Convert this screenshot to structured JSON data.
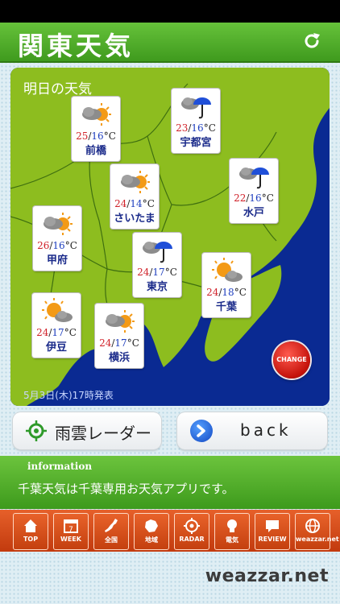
{
  "header": {
    "title": "関東天気",
    "refresh_icon": "refresh-icon"
  },
  "map": {
    "heading": "明日の天気",
    "issued": "5月3日(木)17時発表",
    "colors": {
      "land": "#8dbd1f",
      "sea": "#0a2a92",
      "border": "#3f6f10"
    },
    "cards": [
      {
        "city": "前橋",
        "hi": "25",
        "lo": "16",
        "unit": "°C",
        "icon": "cloudy-sunny-icon"
      },
      {
        "city": "宇都宮",
        "hi": "23",
        "lo": "16",
        "unit": "°C",
        "icon": "cloudy-rain-icon"
      },
      {
        "city": "さいたま",
        "hi": "24",
        "lo": "14",
        "unit": "°C",
        "icon": "cloudy-sunny-icon"
      },
      {
        "city": "水戸",
        "hi": "22",
        "lo": "16",
        "unit": "°C",
        "icon": "cloudy-rain-icon"
      },
      {
        "city": "甲府",
        "hi": "26",
        "lo": "16",
        "unit": "°C",
        "icon": "cloudy-sunny-icon"
      },
      {
        "city": "東京",
        "hi": "24",
        "lo": "17",
        "unit": "°C",
        "icon": "cloudy-rain-icon"
      },
      {
        "city": "千葉",
        "hi": "24",
        "lo": "18",
        "unit": "°C",
        "icon": "sunny-cloudy-icon"
      },
      {
        "city": "伊豆",
        "hi": "24",
        "lo": "17",
        "unit": "°C",
        "icon": "sunny-cloudy-icon"
      },
      {
        "city": "横浜",
        "hi": "24",
        "lo": "17",
        "unit": "°C",
        "icon": "cloudy-sunny-icon"
      }
    ],
    "change_label": "CHANGE"
  },
  "buttons": {
    "radar_label": "雨雲レーダー",
    "back_label": "back"
  },
  "info": {
    "label": "information",
    "text": "千葉天気は千葉専用お天気アプリです。"
  },
  "tabs": [
    {
      "label": "TOP",
      "icon": "home-icon"
    },
    {
      "label": "WEEK",
      "icon": "calendar-icon"
    },
    {
      "label": "全国",
      "icon": "japan-map-icon"
    },
    {
      "label": "地域",
      "icon": "region-map-icon"
    },
    {
      "label": "RADAR",
      "icon": "radar-icon"
    },
    {
      "label": "電気",
      "icon": "lightbulb-icon"
    },
    {
      "label": "REVIEW",
      "icon": "review-icon"
    },
    {
      "label": "weazzar.net",
      "icon": "globe-icon"
    }
  ],
  "brand": "weazzar.net"
}
